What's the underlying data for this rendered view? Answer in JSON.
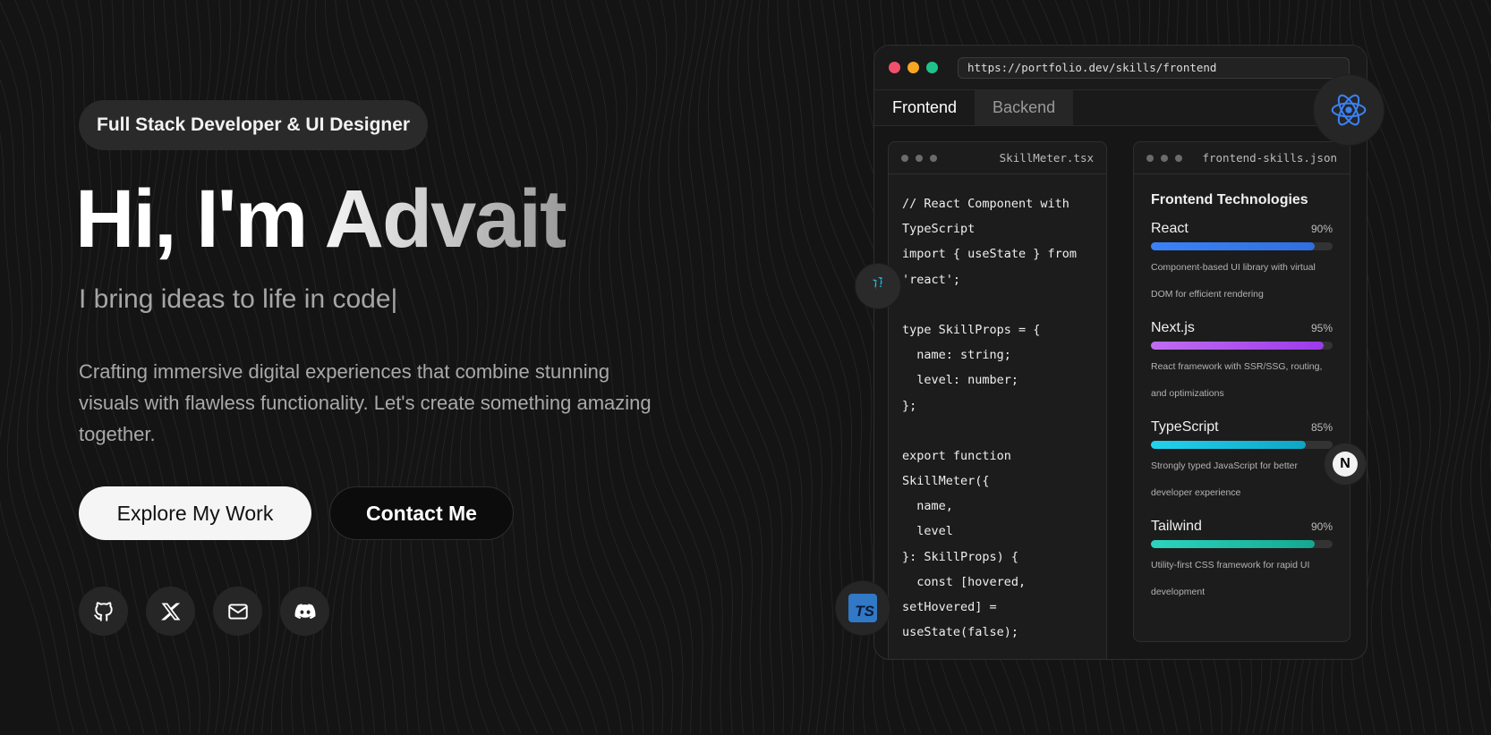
{
  "hero": {
    "badge": "Full Stack Developer & UI Designer",
    "title": "Hi, I'm Advait",
    "tagline": "I bring ideas to life in code",
    "cursor": "|",
    "description": "Crafting immersive digital experiences that combine stunning visuals with flawless functionality. Let's create something amazing together.",
    "primary_button": "Explore My Work",
    "secondary_button": "Contact Me",
    "socials": [
      {
        "icon": "github-icon"
      },
      {
        "icon": "x-icon"
      },
      {
        "icon": "mail-icon"
      },
      {
        "icon": "discord-icon"
      }
    ]
  },
  "browser": {
    "url": "https://portfolio.dev/skills/frontend",
    "traffic_lights": [
      "#f0506e",
      "#f5a623",
      "#1fc38a"
    ],
    "tabs": [
      {
        "label": "Frontend",
        "active": true
      },
      {
        "label": "Backend",
        "active": false
      }
    ],
    "code_panel": {
      "filename": "SkillMeter.tsx",
      "lines": [
        "// React Component with",
        "TypeScript",
        "import { useState } from",
        "'react';",
        "",
        "type SkillProps = {",
        "  name: string;",
        "  level: number;",
        "};",
        "",
        "export function",
        "SkillMeter({",
        "  name,",
        "  level",
        "}: SkillProps) {",
        "  const [hovered,",
        "setHovered] =",
        "useState(false);"
      ]
    },
    "skills_panel": {
      "filename": "frontend-skills.json",
      "title": "Frontend Technologies",
      "skills": [
        {
          "name": "React",
          "percent": "90%",
          "level": 0.9,
          "color": "#3b82f6",
          "color2": "#2f6fe0",
          "desc": "Component-based UI library with virtual DOM for efficient rendering"
        },
        {
          "name": "Next.js",
          "percent": "95%",
          "level": 0.95,
          "color": "#c06cf0",
          "color2": "#9b3bea",
          "desc": "React framework with SSR/SSG, routing, and optimizations"
        },
        {
          "name": "TypeScript",
          "percent": "85%",
          "level": 0.85,
          "color": "#22d3ee",
          "color2": "#0ea5c6",
          "desc": "Strongly typed JavaScript for better developer experience"
        },
        {
          "name": "Tailwind",
          "percent": "90%",
          "level": 0.9,
          "color": "#2dd4bf",
          "color2": "#14a88f",
          "desc": "Utility-first CSS framework for rapid UI development"
        }
      ]
    }
  },
  "floating_icons": [
    "react-icon",
    "tailwind-icon",
    "nextjs-icon",
    "typescript-icon"
  ],
  "floating_labels": {
    "typescript": "TS",
    "nextjs": "N"
  },
  "colors": {
    "background": "#141414",
    "accent_react": "#3b82f6"
  }
}
